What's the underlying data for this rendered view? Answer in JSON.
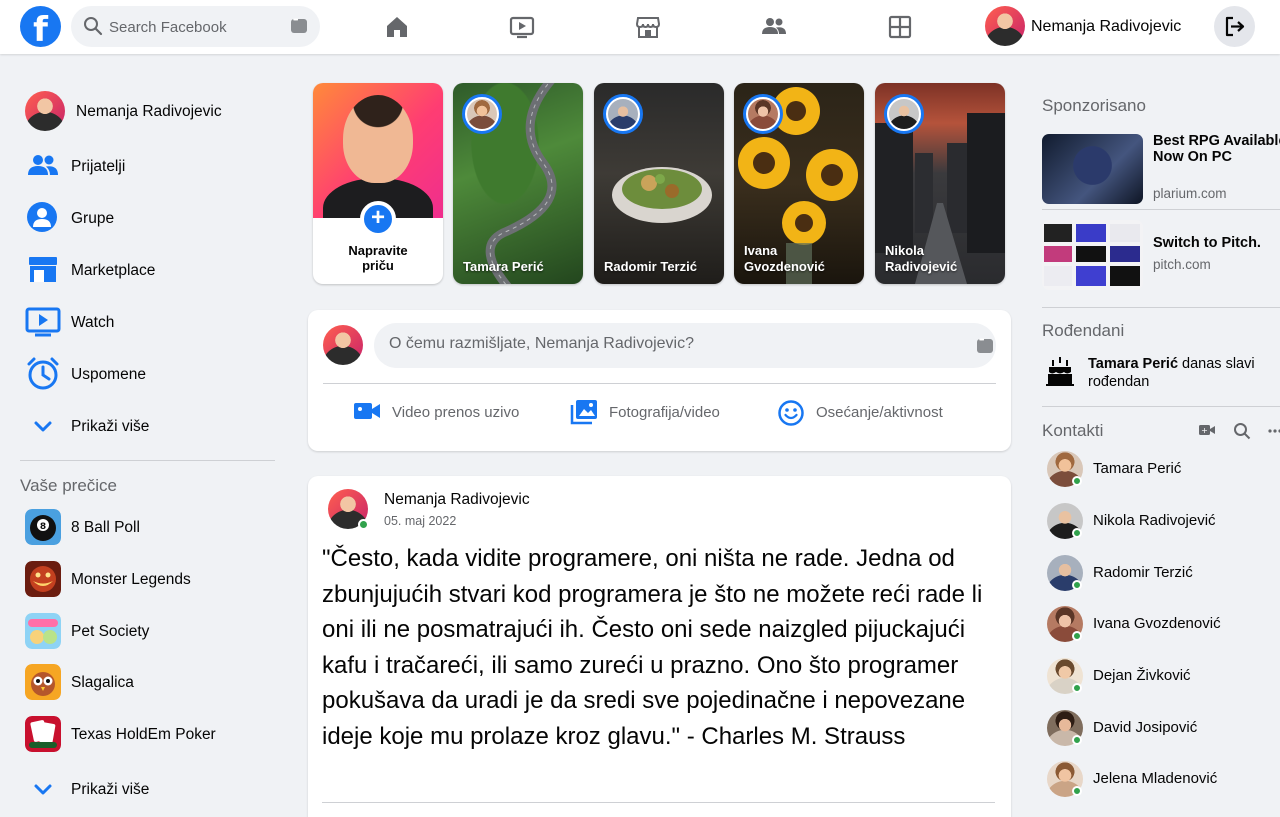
{
  "topbar": {
    "logo": "f",
    "search_placeholder": "Search Facebook",
    "nav": [
      "home-icon",
      "watch-icon",
      "marketplace-icon",
      "groups-icon",
      "gaming-icon"
    ],
    "user_name": "Nemanja Radivojevic"
  },
  "left": {
    "profile_name": "Nemanja Radivojevic",
    "items": [
      {
        "label": "Prijatelji",
        "icon": "friends-icon"
      },
      {
        "label": "Grupe",
        "icon": "groups-icon"
      },
      {
        "label": "Marketplace",
        "icon": "marketplace-icon"
      },
      {
        "label": "Watch",
        "icon": "watch-icon"
      },
      {
        "label": "Uspomene",
        "icon": "memories-icon"
      },
      {
        "label": "Prikaži više",
        "icon": "chevron-down-icon"
      }
    ],
    "shortcuts_title": "Vaše prečice",
    "shortcuts": [
      {
        "label": "8 Ball Poll"
      },
      {
        "label": "Monster Legends"
      },
      {
        "label": "Pet Society"
      },
      {
        "label": "Slagalica"
      },
      {
        "label": "Texas HoldEm Poker"
      }
    ],
    "shortcuts_more": "Prikaži više"
  },
  "stories": {
    "create_label": "Napravite\npriču",
    "items": [
      {
        "name": "Tamara Perić"
      },
      {
        "name": "Radomir Terzić"
      },
      {
        "name": "Ivana Gvozdenović"
      },
      {
        "name": "Nikola Radivojević"
      }
    ]
  },
  "composer": {
    "placeholder": "O čemu razmišljate, Nemanja Radivojevic?",
    "actions": [
      "Video prenos uzivo",
      "Fotografija/video",
      "Osećanje/aktivnost"
    ]
  },
  "post": {
    "author": "Nemanja Radivojevic",
    "date": "05. maj 2022",
    "text": "\"Često, kada vidite programere, oni ništa ne rade. Jedna od zbunjujućih stvari kod programera je što ne možete reći rade li oni ili ne posmatrajući ih. Često oni sede naizgled pijuckajući kafu i tračareći, ili samo zureći u prazno. Ono što programer pokušava da uradi je da sredi sve pojedinačne i nepovezane ideje koje mu prolaze kroz glavu.\" - Charles M. Strauss"
  },
  "right": {
    "sponsored_title": "Sponzorisano",
    "ads": [
      {
        "title": "Best RPG Available Now On PC",
        "url": "plarium.com"
      },
      {
        "title": "Switch to Pitch.",
        "url": "pitch.com"
      }
    ],
    "birthdays_title": "Rođendani",
    "birthday_name": "Tamara Perić",
    "birthday_text": " danas slavi rođendan",
    "contacts_title": "Kontakti",
    "contacts": [
      {
        "name": "Tamara Perić"
      },
      {
        "name": "Nikola Radivojević"
      },
      {
        "name": "Radomir Terzić"
      },
      {
        "name": "Ivana Gvozdenović"
      },
      {
        "name": "Dejan Živković"
      },
      {
        "name": "David Josipović"
      },
      {
        "name": "Jelena Mladenović"
      }
    ]
  },
  "colors": {
    "brand": "#1877f2",
    "background": "#f0f2f5",
    "online": "#31a24c"
  }
}
